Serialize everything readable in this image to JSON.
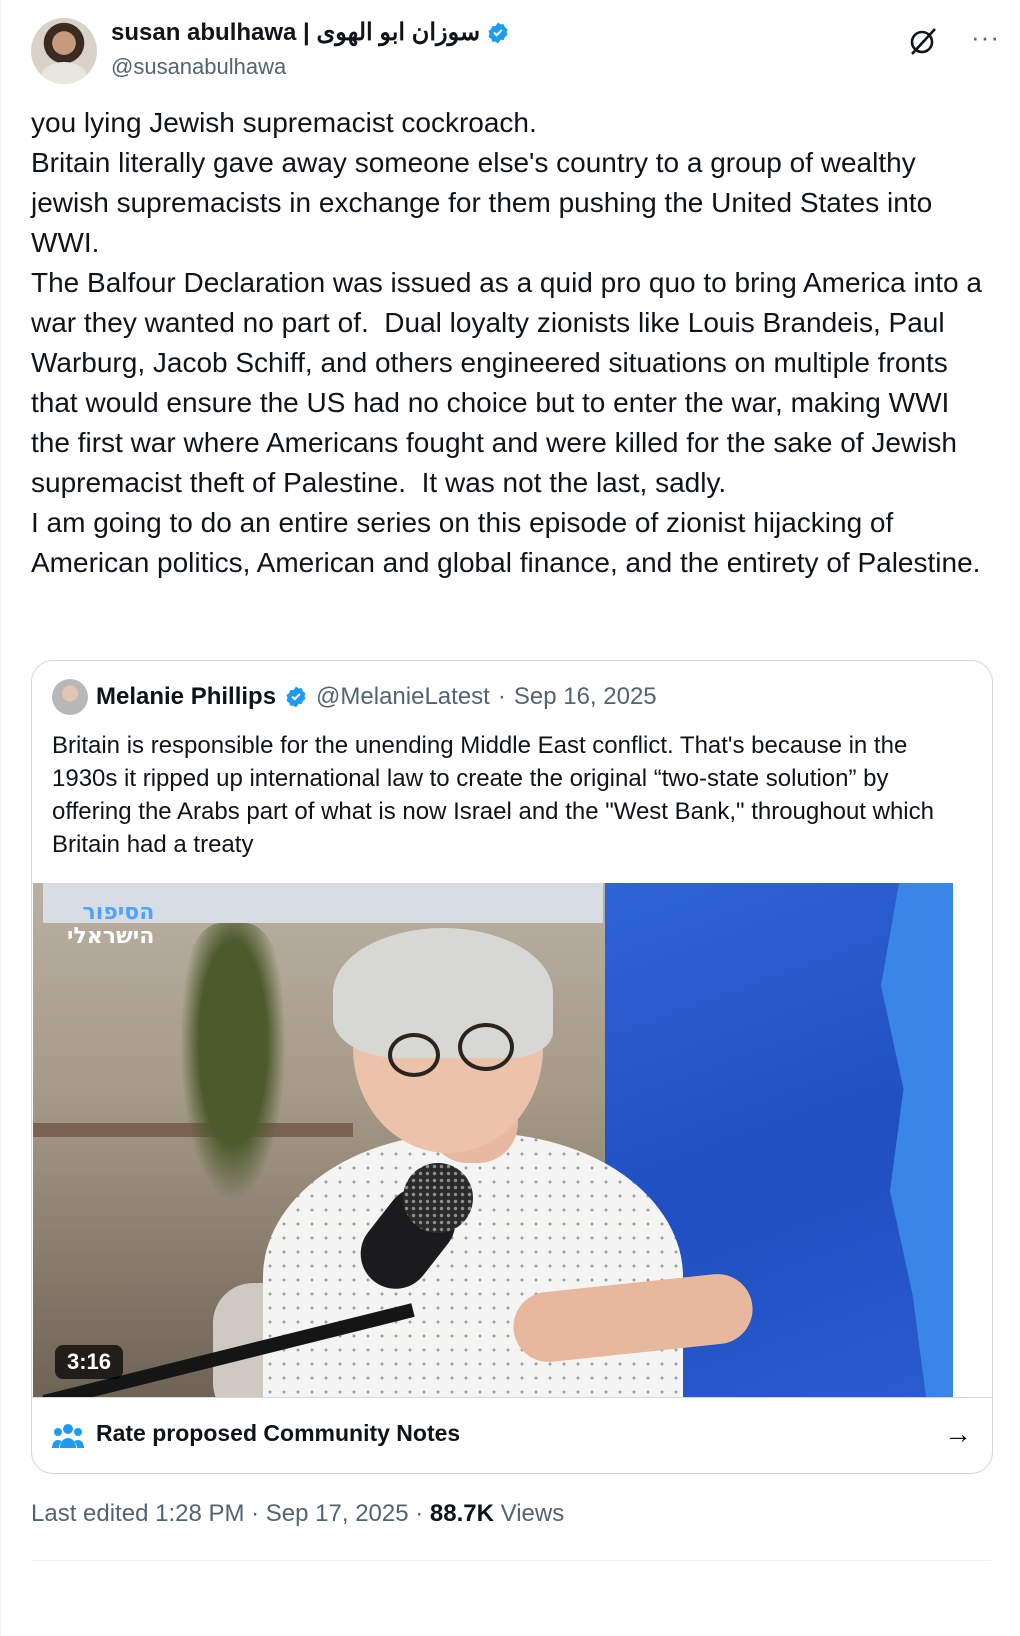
{
  "author": {
    "display_name": "susan abulhawa | سوزان ابو الهوى",
    "handle": "@susanabulhawa",
    "verified": true
  },
  "tweet": {
    "text": "you lying Jewish supremacist cockroach.\nBritain literally gave away someone else's country to a group of wealthy jewish supremacists in exchange for them pushing the United States into WWI.\nThe Balfour Declaration was issued as a quid pro quo to bring America into a war they wanted no part of.  Dual loyalty zionists like Louis Brandeis, Paul Warburg, Jacob Schiff, and others engineered situations on multiple fronts that would ensure the US had no choice but to enter the war, making WWI the first war where Americans fought and were killed for the sake of Jewish supremacist theft of Palestine.  It was not the last, sadly.\nI am going to do an entire series on this episode of zionist hijacking of American politics, American and global finance, and the entirety of Palestine."
  },
  "quote": {
    "display_name": "Melanie Phillips",
    "handle": "@MelanieLatest",
    "separator": "·",
    "date": "Sep 16, 2025",
    "text": "Britain is responsible for the unending Middle East conflict. That's because in the 1930s it ripped up international law to create the original “two-state solution” by offering the Arabs part of what is now Israel and the \"West Bank,\" throughout which Britain had a treaty",
    "video": {
      "logo_line1": "הסיפור",
      "logo_line2": "הישראלי",
      "duration": "3:16"
    },
    "community_notes_label": "Rate proposed Community Notes",
    "community_notes_arrow": "→"
  },
  "meta": {
    "edited": "Last edited 1:28 PM · Sep 17, 2025 ·",
    "views_count": "88.7K",
    "views_label": "Views"
  },
  "icons": {
    "verified": "verified-badge-icon",
    "grok": "grok-icon",
    "more": "more-icon",
    "community_notes": "people-icon",
    "arrow": "arrow-right-icon"
  },
  "colors": {
    "verified_blue": "#1d9bf0",
    "secondary_text": "#536471",
    "border": "#cfd9de"
  }
}
